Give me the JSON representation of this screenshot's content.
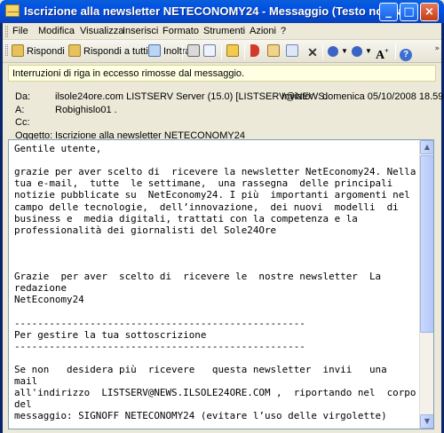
{
  "window": {
    "title": "Iscrizione alla newsletter NETECONOMY24 - Messaggio (Testo normale)",
    "minimize": "_",
    "maximize": "□",
    "close": "×"
  },
  "menu": [
    {
      "label": "File"
    },
    {
      "label": "Modifica"
    },
    {
      "label": "Visualizza"
    },
    {
      "label": "Inserisci"
    },
    {
      "label": "Formato"
    },
    {
      "label": "Strumenti"
    },
    {
      "label": "Azioni"
    },
    {
      "label": "?"
    }
  ],
  "toolbar": {
    "reply": "Rispondi",
    "reply_all": "Rispondi a tutti",
    "forward": "Inoltra",
    "font_size_icon": "A"
  },
  "infobar": "Interruzioni di riga in eccesso rimosse dal messaggio.",
  "headers": {
    "from_label": "Da:",
    "from_value": "ilsole24ore.com LISTSERV Server (15.0) [LISTSERV@NEWS.",
    "sent_label": "Inviato:",
    "sent_value": "domenica 05/10/2008 18.59",
    "to_label": "A:",
    "to_value": "Robighislo01 .",
    "cc_label": "Cc:",
    "cc_value": "",
    "subject_label": "Oggetto:",
    "subject_value": "Iscrizione alla newsletter NETECONOMY24"
  },
  "body_lines": [
    "Gentile utente,",
    "",
    "grazie per aver scelto di  ricevere la newsletter NetEconomy24. Nella",
    "tua e-mail,  tutte  le settimane,  una rassegna  delle principali",
    "notizie pubblicate su  NetEconomy24. I più  importanti argomenti nel",
    "campo delle tecnologie,  dell’innovazione,  dei nuovi  modelli  di",
    "business e  media digitali, trattati con la competenza e la",
    "professionalità dei giornalisti del Sole24Ore",
    "",
    "",
    "",
    "Grazie  per aver  scelto di  ricevere le  nostre newsletter  La",
    "redazione",
    "NetEconomy24",
    "",
    "--------------------------------------------------",
    "Per gestire la tua sottoscrizione",
    "--------------------------------------------------",
    "",
    "Se non   desidera più  ricevere   questa newsletter  invii   una",
    "mail",
    "all'indirizzo  LISTSERV@NEWS.ILSOLE24ORE.COM ,  riportando nel  corpo",
    "del",
    "messaggio: SIGNOFF NETECONOMY24 (evitare l’uso delle virgolette)"
  ]
}
